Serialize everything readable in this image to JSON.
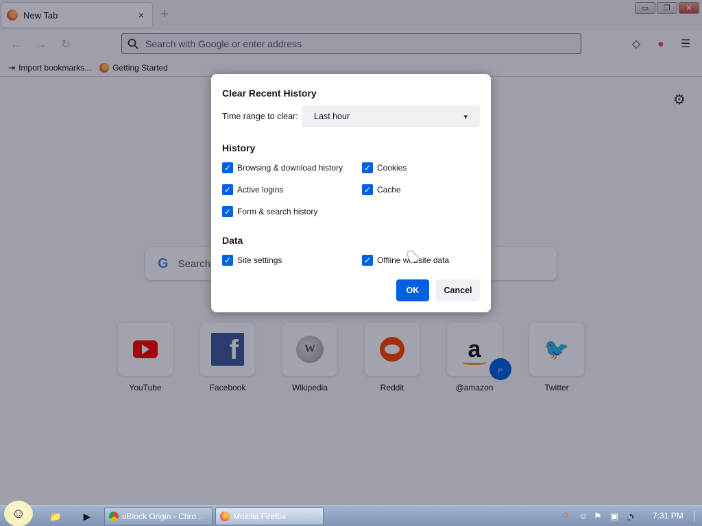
{
  "browser": {
    "tab": {
      "title": "New Tab",
      "close": "×"
    },
    "new_tab_symbol": "+",
    "window_controls": {
      "minimize": "▭",
      "restore": "❐",
      "close": "✕"
    },
    "nav": {
      "back": "←",
      "forward": "→",
      "reload": "↻"
    },
    "urlbar": {
      "placeholder": "Search with Google or enter address"
    },
    "right_buttons": {
      "pocket": "◇",
      "account": "●",
      "menu": "☰"
    },
    "bookmarks": [
      {
        "label": "Import bookmarks...",
        "icon": "import-icon"
      },
      {
        "label": "Getting Started",
        "icon": "firefox-icon"
      }
    ]
  },
  "newtab": {
    "search_label": "Search",
    "google_letter": "G",
    "tiles": [
      {
        "label": "YouTube"
      },
      {
        "label": "Facebook"
      },
      {
        "label": "Wikipedia"
      },
      {
        "label": "Reddit"
      },
      {
        "label": "@amazon"
      },
      {
        "label": "Twitter"
      }
    ]
  },
  "dialog": {
    "title": "Clear Recent History",
    "time_range_label": "Time range to clear:",
    "time_range_value": "Last hour",
    "history_section": "History",
    "history_items": [
      {
        "label": "Browsing & download history",
        "checked": true
      },
      {
        "label": "Cookies",
        "checked": true
      },
      {
        "label": "Active logins",
        "checked": true
      },
      {
        "label": "Cache",
        "checked": true
      },
      {
        "label": "Form & search history",
        "checked": true
      }
    ],
    "data_section": "Data",
    "data_items": [
      {
        "label": "Site settings",
        "checked": true
      },
      {
        "label": "Offline website data",
        "checked": true
      }
    ],
    "ok_label": "OK",
    "cancel_label": "Cancel"
  },
  "taskbar": {
    "tasks": [
      {
        "label": "uBlock Origin - Chro...",
        "icon": "chrome-icon"
      },
      {
        "label": "Mozilla Firefox",
        "icon": "firefox-icon",
        "active": true
      }
    ],
    "clock": "7:31 PM"
  },
  "colors": {
    "accent": "#0061e0",
    "overlay": "#0c0c28"
  }
}
